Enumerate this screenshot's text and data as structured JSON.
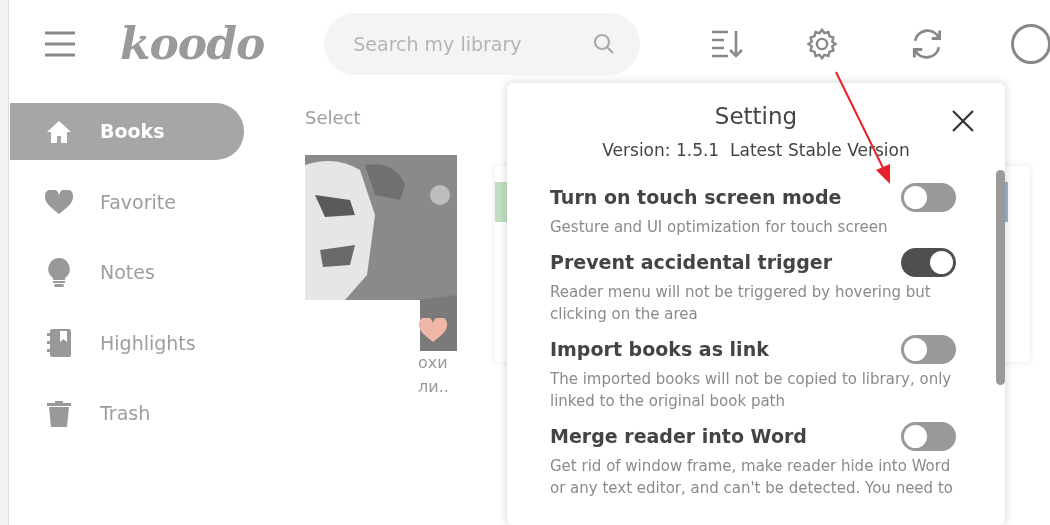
{
  "header": {
    "logo": "koodo",
    "search": {
      "placeholder": "Search my library"
    }
  },
  "sidebar": {
    "items": [
      {
        "label": "Books",
        "kind": "home",
        "selected": true
      },
      {
        "label": "Favorite",
        "kind": "heart",
        "selected": false
      },
      {
        "label": "Notes",
        "kind": "bulb",
        "selected": false
      },
      {
        "label": "Highlights",
        "kind": "notebook",
        "selected": false
      },
      {
        "label": "Trash",
        "kind": "trash",
        "selected": false
      }
    ]
  },
  "library": {
    "select_label": "Select",
    "book": {
      "kind": "picture",
      "favorite": true,
      "title_lines": [
        "охи",
        "ли.."
      ]
    }
  },
  "settings_dialog": {
    "title": "Setting",
    "version": "Version: 1.5.1  Latest Stable Version",
    "options": [
      {
        "title": "Turn on touch screen mode",
        "description": "Gesture and UI optimization for touch screen",
        "on": false
      },
      {
        "title": "Prevent accidental trigger",
        "description": "Reader menu will not be triggered by hovering but clicking on the area",
        "on": true
      },
      {
        "title": "Import books as link",
        "description": "The imported books will not be copied to library, only linked to the original book path",
        "on": false
      },
      {
        "title": "Merge reader into Word",
        "description": "Get rid of window frame, make reader hide into Word or any text editor, and can't be detected. You need to",
        "on": false
      }
    ]
  }
}
